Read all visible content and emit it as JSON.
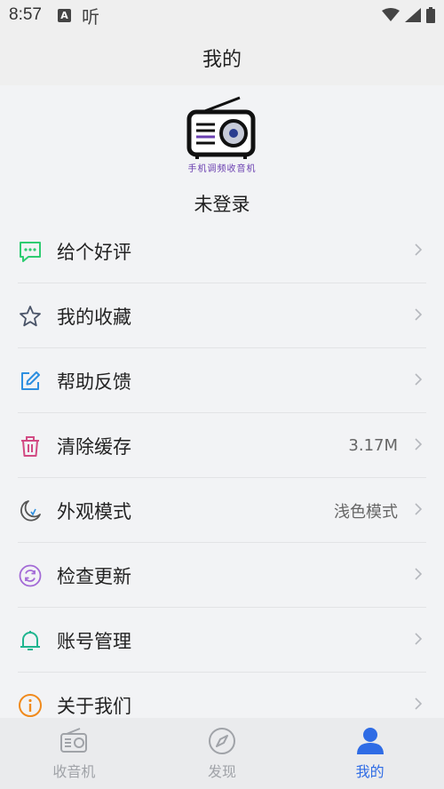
{
  "status_bar": {
    "time": "8:57",
    "a_badge": "A",
    "app_glyph": "听",
    "icons": [
      "wifi-icon",
      "signal-icon",
      "battery-icon"
    ]
  },
  "header": {
    "title": "我的"
  },
  "profile": {
    "logo_caption": "手机调频收音机",
    "login_status": "未登录"
  },
  "menu": {
    "items": [
      {
        "label": "给个好评",
        "icon": "chat-bubble-icon",
        "color": "#2ecc71",
        "value": ""
      },
      {
        "label": "我的收藏",
        "icon": "star-icon",
        "color": "#4a5468",
        "value": ""
      },
      {
        "label": "帮助反馈",
        "icon": "edit-icon",
        "color": "#2d8fe0",
        "value": ""
      },
      {
        "label": "清除缓存",
        "icon": "trash-icon",
        "color": "#d24a83",
        "value": "3.17M"
      },
      {
        "label": "外观模式",
        "icon": "moon-icon",
        "color": "#555555",
        "value": "浅色模式"
      },
      {
        "label": "检查更新",
        "icon": "refresh-icon",
        "color": "#a36ad6",
        "value": ""
      },
      {
        "label": "账号管理",
        "icon": "bell-icon",
        "color": "#1fb58f",
        "value": ""
      },
      {
        "label": "关于我们",
        "icon": "info-icon",
        "color": "#f08a1c",
        "value": ""
      }
    ]
  },
  "bottom_nav": {
    "items": [
      {
        "label": "收音机",
        "icon": "radio-icon",
        "active": false
      },
      {
        "label": "发现",
        "icon": "compass-icon",
        "active": false
      },
      {
        "label": "我的",
        "icon": "person-icon",
        "active": true
      }
    ],
    "active_color": "#2f6ce5",
    "inactive_color": "#a0a3a8"
  }
}
